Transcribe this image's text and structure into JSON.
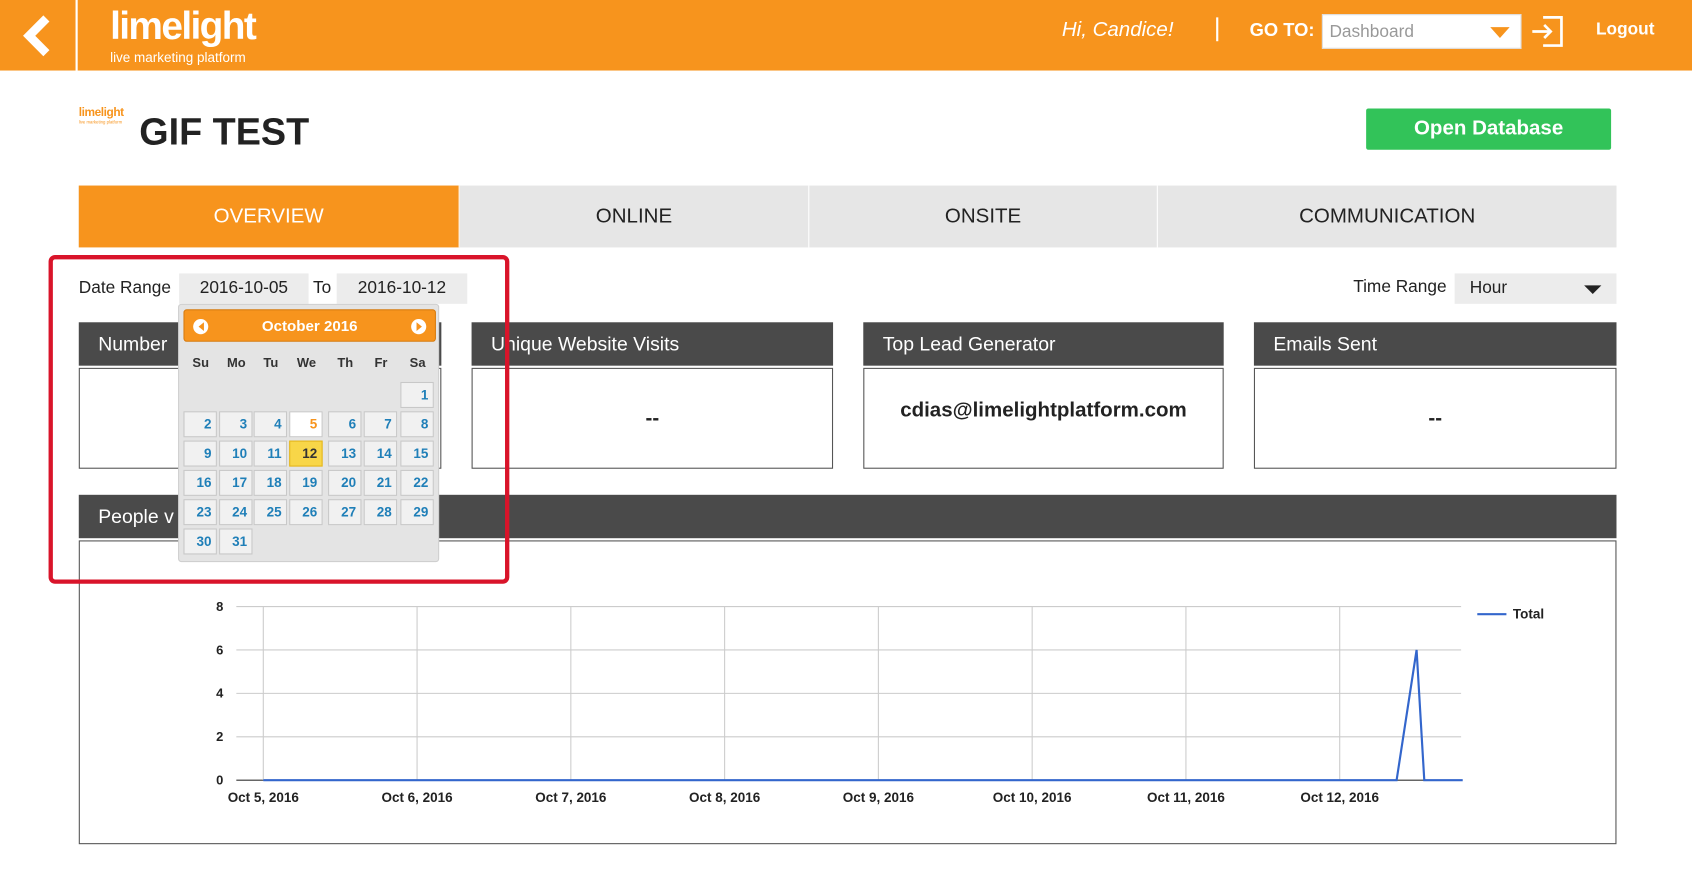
{
  "header": {
    "brand": "limelight",
    "tagline": "live marketing platform",
    "greeting": "Hi,  Candice!",
    "goto_label": "GO TO:",
    "goto_value": "Dashboard",
    "logout": "Logout"
  },
  "page": {
    "title": "GIF TEST",
    "open_db": "Open Database"
  },
  "tabs": [
    {
      "label": "OVERVIEW"
    },
    {
      "label": "ONLINE"
    },
    {
      "label": "ONSITE"
    },
    {
      "label": "COMMUNICATION"
    }
  ],
  "filters": {
    "date_range_label": "Date Range",
    "from": "2016-10-05",
    "to_label": "To",
    "to": "2016-10-12",
    "time_range_label": "Time Range",
    "time_range_value": "Hour"
  },
  "cards": [
    {
      "title": "Number",
      "value": ""
    },
    {
      "title": "Unique Website Visits",
      "value": "--"
    },
    {
      "title": "Top Lead Generator",
      "value": "cdias@limelightplatform.com"
    },
    {
      "title": "Emails Sent",
      "value": "--"
    }
  ],
  "people_title": "People v",
  "datepicker": {
    "month": "October 2016",
    "weekdays": [
      "Su",
      "Mo",
      "Tu",
      "We",
      "Th",
      "Fr",
      "Sa"
    ],
    "first_weekday": 6,
    "days_in_month": 31,
    "selected_start": 5,
    "today": 12
  },
  "colors": {
    "accent": "#f7941d",
    "button_green": "#32c359",
    "dark_header": "#4a4a4a",
    "line": "#3366cc",
    "highlight": "#d9142a"
  },
  "chart_data": {
    "type": "line",
    "categories": [
      "Oct 5, 2016",
      "Oct 6, 2016",
      "Oct 7, 2016",
      "Oct 8, 2016",
      "Oct 9, 2016",
      "Oct 10, 2016",
      "Oct 11, 2016",
      "Oct 12, 2016"
    ],
    "yticks": [
      0,
      2,
      4,
      6,
      8
    ],
    "ylim": [
      0,
      8
    ],
    "series": [
      {
        "name": "Total",
        "points": [
          {
            "day": 0,
            "value": 0
          },
          {
            "day": 7.37,
            "value": 0
          },
          {
            "day": 7.5,
            "value": 6
          },
          {
            "day": 7.55,
            "value": 0
          },
          {
            "day": 7.8,
            "value": 0
          }
        ]
      }
    ],
    "legend": "right"
  }
}
